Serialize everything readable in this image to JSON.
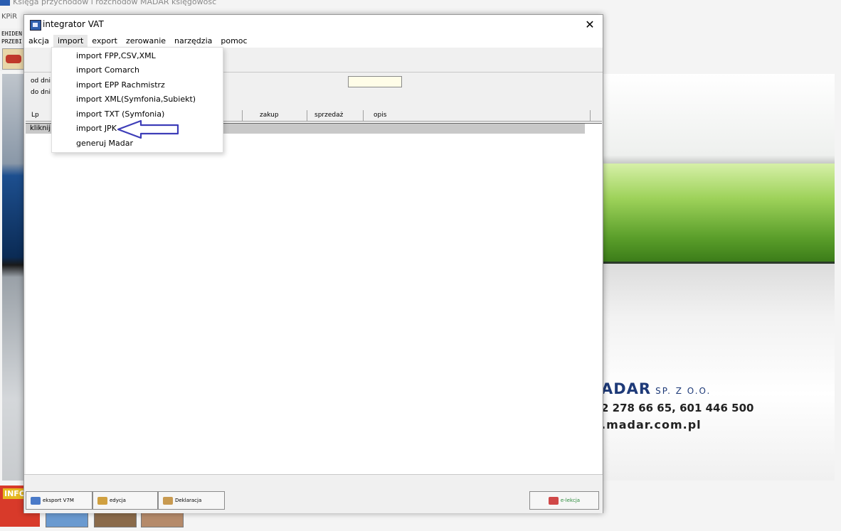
{
  "background_app": {
    "title": "Księga przychodów i rozchodów MADAR  księgowość",
    "kpir": "KPiR",
    "side_text_1": "EHIDEN",
    "side_text_2": "PRZEBI",
    "company": "ADAR",
    "company_suffix": "SP. Z O.O.",
    "phones": "2 278 66 65, 601 446 500",
    "website": ".madar.com.pl",
    "info_label": "INFO"
  },
  "dialog": {
    "title": "integrator VAT",
    "close_glyph": "✕",
    "menu": [
      "akcja",
      "import",
      "export",
      "zerowanie",
      "narzędzia",
      "pomoc"
    ],
    "filters": {
      "from_label": "od dni",
      "to_label": "do dni"
    },
    "columns": [
      "Lp",
      "zakup",
      "sprzedaż",
      "opis"
    ],
    "first_row_text": "kliknij",
    "buttons": {
      "eksport": "eksport V7M",
      "edycja": "edycja",
      "deklaracja": "Deklaracja",
      "eleklacja": "e-lekcja"
    }
  },
  "import_menu": {
    "items": [
      "import FPP,CSV,XML",
      "import Comarch",
      "import EPP Rachmistrz",
      "import XML(Symfonia,Subiekt)",
      "import TXT (Symfonia)",
      "import JPK",
      "generuj Madar"
    ],
    "highlighted": "import JPK",
    "arrow_color": "#3d3db8"
  }
}
